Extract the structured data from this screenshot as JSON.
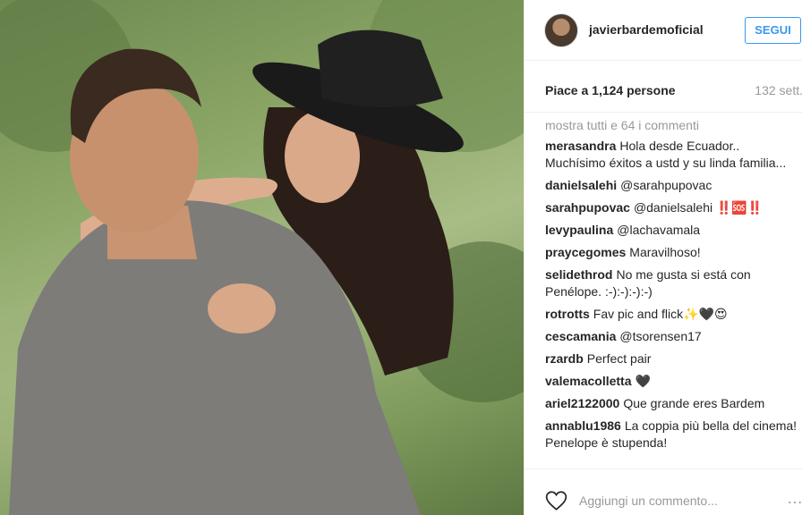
{
  "post": {
    "username": "javierbardemoficial",
    "follow_label": "SEGUI",
    "likes_text": "Piace a 1,124 persone",
    "time_ago": "132 sett.",
    "show_all_comments": "mostra tutti e 64 i commenti",
    "add_comment_placeholder": "Aggiungi un commento...",
    "more_options": "…"
  },
  "comments": [
    {
      "user": "merasandra",
      "text": "Hola desde Ecuador.. Muchísimo éxitos a ustd y su linda familia..."
    },
    {
      "user": "danielsalehi",
      "text": "@sarahpupovac"
    },
    {
      "user": "sarahpupovac",
      "text": "@danielsalehi ‼️🆘‼️"
    },
    {
      "user": "levypaulina",
      "text": "@lachavamala"
    },
    {
      "user": "praycegomes",
      "text": "Maravilhoso!"
    },
    {
      "user": "selidethrod",
      "text": "No me gusta si está con Penélope. :-):-):-):-)"
    },
    {
      "user": "rotrotts",
      "text": "Fav pic and flick✨🖤😍"
    },
    {
      "user": "cescamania",
      "text": "@tsorensen17"
    },
    {
      "user": "rzardb",
      "text": "Perfect pair"
    },
    {
      "user": "valemacolletta",
      "text": "🖤"
    },
    {
      "user": "ariel2122000",
      "text": "Que grande eres Bardem"
    },
    {
      "user": "annablu1986",
      "text": "La coppia più bella del cinema! Penelope è stupenda!"
    }
  ],
  "colors": {
    "accent": "#3897f0",
    "muted": "#999999",
    "text": "#262626"
  },
  "icons": {
    "like": "heart-outline-icon",
    "avatar": "profile-avatar"
  }
}
